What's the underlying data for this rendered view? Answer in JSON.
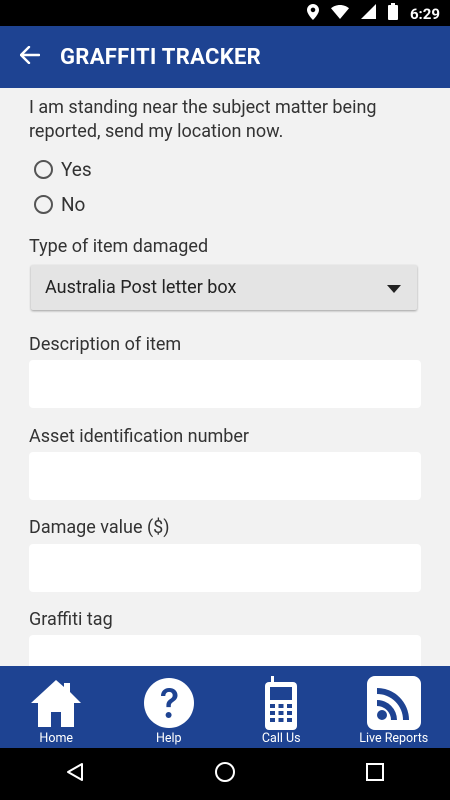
{
  "status": {
    "time": "6:29"
  },
  "appbar": {
    "title": "GRAFFITI TRACKER"
  },
  "form": {
    "location_question": "I am standing near the subject matter being reported, send my location now.",
    "yes_label": "Yes",
    "no_label": "No",
    "item_type_label": "Type of item damaged",
    "item_type_value": "Australia Post letter box",
    "description_label": "Description of item",
    "asset_id_label": "Asset identification number",
    "damage_value_label": "Damage value ($)",
    "graffiti_tag_label": "Graffiti tag"
  },
  "bottomnav": {
    "home": "Home",
    "help": "Help",
    "call_us": "Call Us",
    "live_reports": "Live Reports"
  },
  "colors": {
    "primary": "#1e4392",
    "field_bg": "#ffffff",
    "page_bg": "#f2f2f2"
  }
}
